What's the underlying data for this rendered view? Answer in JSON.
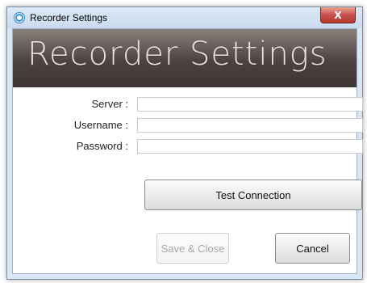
{
  "window": {
    "title": "Recorder Settings",
    "close_label": "X"
  },
  "banner": {
    "title": "Recorder Settings"
  },
  "form": {
    "server_label": "Server :",
    "server_value": "",
    "username_label": "Username :",
    "username_value": "",
    "password_label": "Password :",
    "password_value": ""
  },
  "buttons": {
    "test_connection": "Test Connection",
    "save_close": "Save & Close",
    "cancel": "Cancel"
  },
  "colors": {
    "banner_dark": "#3e3634",
    "titlebar": "#dce9f6",
    "close_red": "#c75050"
  }
}
